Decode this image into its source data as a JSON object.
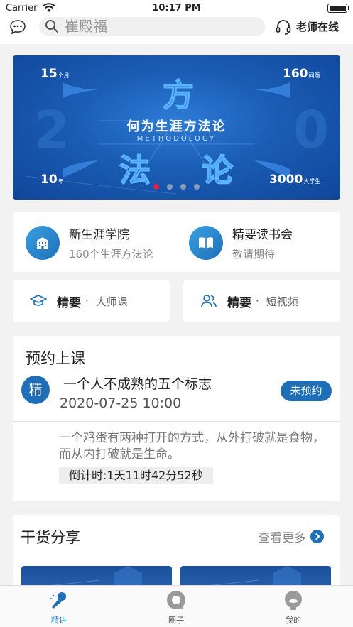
{
  "status_bar": {
    "carrier": "Carrier",
    "time": "10:17 PM"
  },
  "top_bar": {
    "search_placeholder": "崔殿福",
    "teacher_label": "老师在线"
  },
  "banner": {
    "title": "何为生涯方法论",
    "subtitle": "METHODOLOGY",
    "big_chars": [
      "方",
      "法",
      "论"
    ],
    "stats": [
      {
        "value": "15",
        "unit": "个月"
      },
      {
        "value": "160",
        "unit": "问题"
      },
      {
        "value": "10",
        "unit": "年"
      },
      {
        "value": "3000",
        "unit": "大学生"
      }
    ],
    "page_count": 4,
    "active_page": 1
  },
  "features": [
    {
      "title": "新生涯学院",
      "subtitle": "160个生涯方法论",
      "icon": "building-icon"
    },
    {
      "title": "精要读书会",
      "subtitle": "敬请期待",
      "icon": "book-icon"
    }
  ],
  "quick_links": [
    {
      "strong": "精要",
      "sep": "·",
      "light": "大师课",
      "icon": "graduation-cap-icon"
    },
    {
      "strong": "精要",
      "sep": "·",
      "light": "短视频",
      "icon": "users-icon"
    }
  ],
  "booking": {
    "heading": "预约上课",
    "badge": "精",
    "lesson_title": "一个人不成熟的五个标志",
    "lesson_time": "2020-07-25 10:00",
    "button_label": "未预约",
    "quote": "一个鸡蛋有两种打开的方式，从外打破就是食物，而从内打破就是生命。",
    "countdown": "倒计时:1天11时42分52秒"
  },
  "share": {
    "heading": "干货分享",
    "more_label": "查看更多"
  },
  "tabs": [
    {
      "label": "精讲",
      "icon": "microphone-icon",
      "active": true
    },
    {
      "label": "圈子",
      "icon": "circle-icon",
      "active": false
    },
    {
      "label": "我的",
      "icon": "profile-icon",
      "active": false
    }
  ],
  "colors": {
    "primary": "#1f6fb8",
    "active_dot": "#e8213a",
    "background": "#f2f2f2"
  }
}
